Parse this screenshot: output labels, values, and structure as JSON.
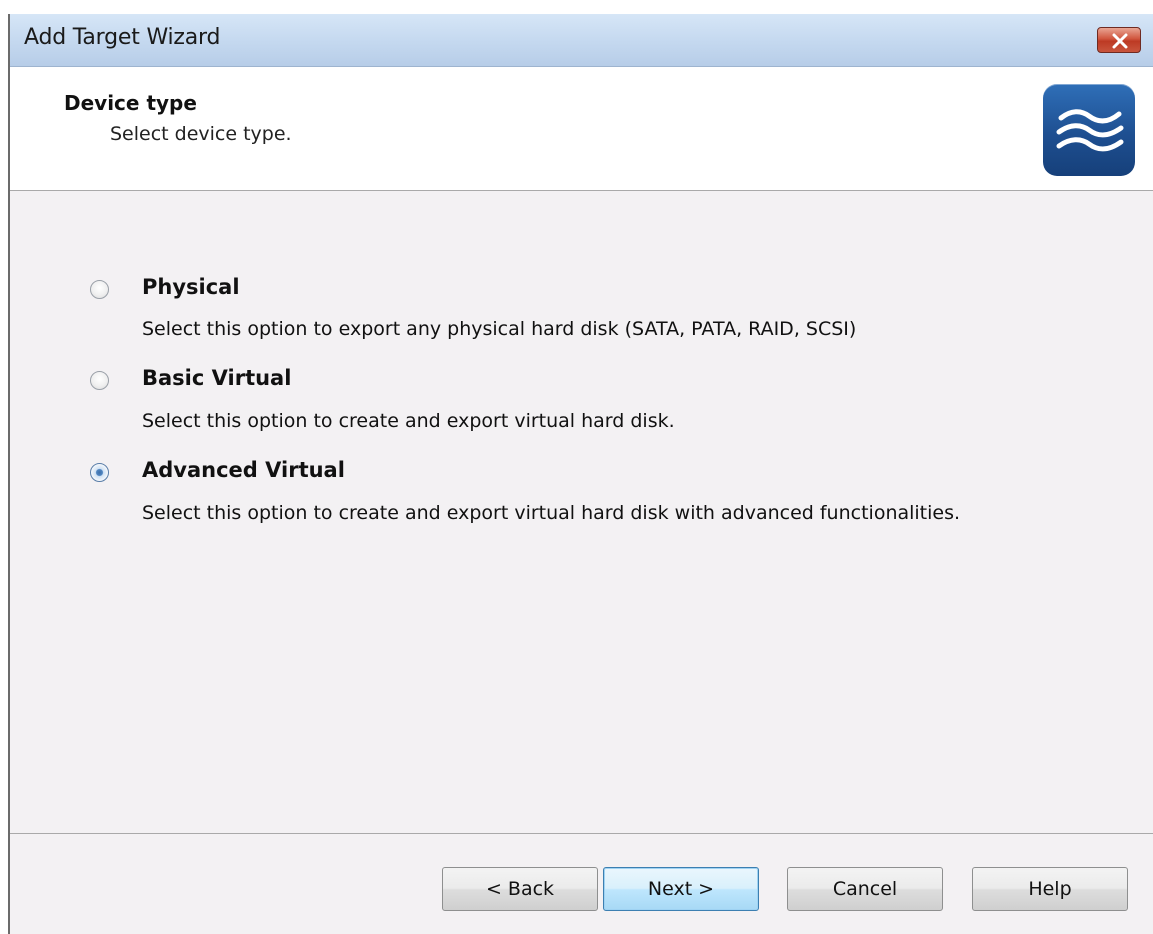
{
  "window": {
    "title": "Add Target Wizard",
    "close_icon": "close-icon"
  },
  "header": {
    "title": "Device type",
    "subtitle": "Select device type.",
    "logo_icon": "wave-logo-icon"
  },
  "options": [
    {
      "label": "Physical",
      "description": "Select this option to export any physical hard disk (SATA, PATA, RAID, SCSI)",
      "selected": false
    },
    {
      "label": "Basic Virtual",
      "description": "Select this option to create and export virtual hard disk.",
      "selected": false
    },
    {
      "label": "Advanced Virtual",
      "description": "Select this option to create and export virtual hard disk with advanced functionalities.",
      "selected": true
    }
  ],
  "buttons": {
    "back": "< Back",
    "next": "Next >",
    "cancel": "Cancel",
    "help": "Help"
  },
  "colors": {
    "accent": "#1e4f91",
    "close": "#c8553d"
  }
}
